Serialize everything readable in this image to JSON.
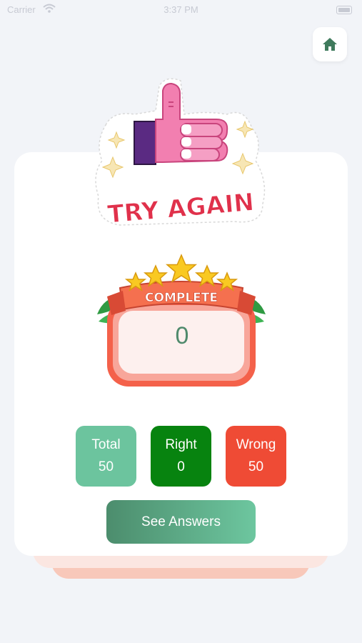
{
  "status_bar": {
    "carrier": "Carrier",
    "time": "3:37 PM"
  },
  "home_button": {
    "icon": "home-icon",
    "color": "#3f7a5c"
  },
  "result": {
    "title": "TRY AGAIN",
    "badge_label": "COMPLETE",
    "score": "0"
  },
  "stats": {
    "total": {
      "label": "Total",
      "value": "50",
      "color": "#6cc49e"
    },
    "right": {
      "label": "Right",
      "value": "0",
      "color": "#07830f"
    },
    "wrong": {
      "label": "Wrong",
      "value": "50",
      "color": "#ef4b35"
    }
  },
  "see_answers": {
    "label": "See Answers"
  }
}
